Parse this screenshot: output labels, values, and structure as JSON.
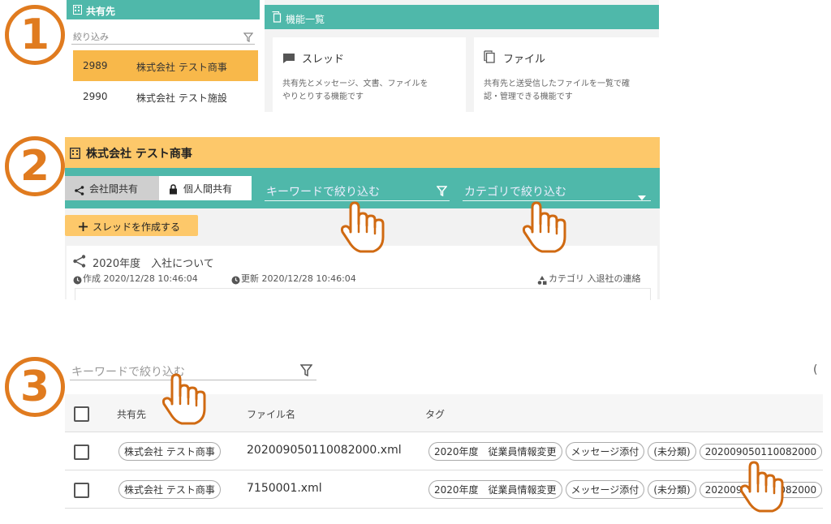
{
  "step_numbers": [
    "1",
    "2",
    "3"
  ],
  "section1": {
    "sidebar": {
      "header": "共有先",
      "filter_placeholder": "絞り込み",
      "items": [
        {
          "id": "2989",
          "name": "株式会社 テスト商事",
          "selected": true
        },
        {
          "id": "2990",
          "name": "株式会社 テスト施設",
          "selected": false
        }
      ]
    },
    "features": {
      "header": "機能一覧",
      "cards": [
        {
          "title": "スレッド",
          "icon": "chat-icon",
          "desc_line1": "共有先とメッセージ、文書、ファイルを",
          "desc_line2": "やりとりする機能です"
        },
        {
          "title": "ファイル",
          "icon": "file-icon",
          "desc_line1": "共有先と送受信したファイルを一覧で確",
          "desc_line2": "認・管理できる機能です"
        }
      ]
    }
  },
  "section2": {
    "title": "株式会社 テスト商事",
    "tabs": [
      {
        "label": "会社間共有",
        "icon": "share-icon",
        "active": true
      },
      {
        "label": "個人間共有",
        "icon": "lock-icon",
        "active": false
      }
    ],
    "keyword_placeholder": "キーワードで絞り込む",
    "category_placeholder": "カテゴリで絞り込む",
    "create_thread_label": "スレッドを作成する",
    "thread": {
      "title": "2020年度　入社について",
      "created": "作成 2020/12/28 10:46:04",
      "updated": "更新 2020/12/28 10:46:04",
      "category": "カテゴリ  入退社の連絡"
    }
  },
  "section3": {
    "keyword_placeholder": "キーワードで絞り込む",
    "right_edge_text": "(",
    "columns": {
      "share_target": "共有先",
      "file_name": "ファイル名",
      "tags": "タグ"
    },
    "rows": [
      {
        "share_target": "株式会社 テスト商事",
        "file_name": "202009050110082000.xml",
        "tags": [
          "2020年度　従業員情報変更",
          "メッセージ添付",
          "(未分類)",
          "202009050110082000"
        ]
      },
      {
        "share_target": "株式会社 テスト商事",
        "file_name": "7150001.xml",
        "tags": [
          "2020年度　従業員情報変更",
          "メッセージ添付",
          "(未分類)",
          "202009050110082000"
        ]
      }
    ]
  },
  "colors": {
    "teal": "#4fb8aa",
    "orange_header": "#fdc86a",
    "selected_row": "#f8b84a",
    "accent_step": "#e07b1f"
  }
}
